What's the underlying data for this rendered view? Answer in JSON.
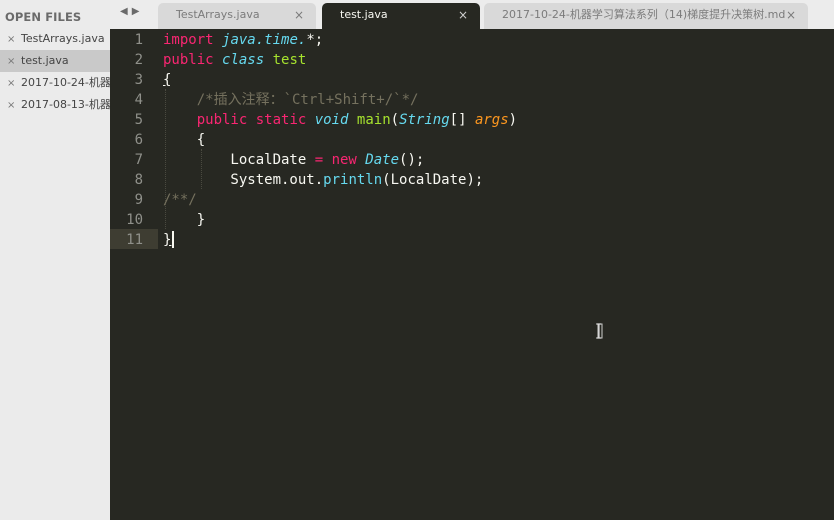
{
  "sidebar": {
    "title": "OPEN FILES",
    "close_glyph": "×",
    "files": [
      {
        "name": "TestArrays.java"
      },
      {
        "name": "test.java"
      },
      {
        "name": "2017-10-24-机器"
      },
      {
        "name": "2017-08-13-机器"
      }
    ]
  },
  "tabs": {
    "nav_prev": "◀",
    "nav_next": "▶",
    "close_glyph": "×",
    "items": [
      {
        "label": "TestArrays.java"
      },
      {
        "label": "test.java"
      },
      {
        "label": "2017-10-24-机器学习算法系列（14)梯度提升决策树.md"
      }
    ]
  },
  "editor": {
    "line_numbers": [
      "1",
      "2",
      "3",
      "4",
      "5",
      "6",
      "7",
      "8",
      "9",
      "10",
      "11"
    ],
    "lines": [
      [
        {
          "t": "import ",
          "c": "kw"
        },
        {
          "t": "java.time.",
          "c": "ns"
        },
        {
          "t": "*;",
          "c": "pl"
        }
      ],
      [
        {
          "t": "public ",
          "c": "kw"
        },
        {
          "t": "class ",
          "c": "ty"
        },
        {
          "t": "test",
          "c": "cls"
        }
      ],
      [
        {
          "t": "{",
          "c": "pl brace-ul"
        }
      ],
      [
        {
          "t": "    ",
          "c": "pl"
        },
        {
          "t": "/*插入注释：`Ctrl+Shift+/`*/",
          "c": "cm"
        }
      ],
      [
        {
          "t": "    ",
          "c": "pl"
        },
        {
          "t": "public ",
          "c": "kw"
        },
        {
          "t": "static ",
          "c": "kw"
        },
        {
          "t": "void ",
          "c": "ty"
        },
        {
          "t": "main",
          "c": "cls"
        },
        {
          "t": "(",
          "c": "pl"
        },
        {
          "t": "String",
          "c": "ty"
        },
        {
          "t": "[] ",
          "c": "pl"
        },
        {
          "t": "args",
          "c": "arg"
        },
        {
          "t": ")",
          "c": "pl"
        }
      ],
      [
        {
          "t": "    {",
          "c": "pl"
        }
      ],
      [
        {
          "t": "        LocalDate ",
          "c": "pl"
        },
        {
          "t": "= ",
          "c": "kw"
        },
        {
          "t": "new ",
          "c": "kw"
        },
        {
          "t": "Date",
          "c": "ty"
        },
        {
          "t": "();",
          "c": "pl"
        }
      ],
      [
        {
          "t": "        System.out.",
          "c": "pl"
        },
        {
          "t": "println",
          "c": "fn"
        },
        {
          "t": "(LocalDate);",
          "c": "pl"
        }
      ],
      [
        {
          "t": "/**/",
          "c": "cm"
        }
      ],
      [
        {
          "t": "    }",
          "c": "pl"
        }
      ],
      [
        {
          "t": "}",
          "c": "pl brace-ul"
        }
      ]
    ]
  }
}
